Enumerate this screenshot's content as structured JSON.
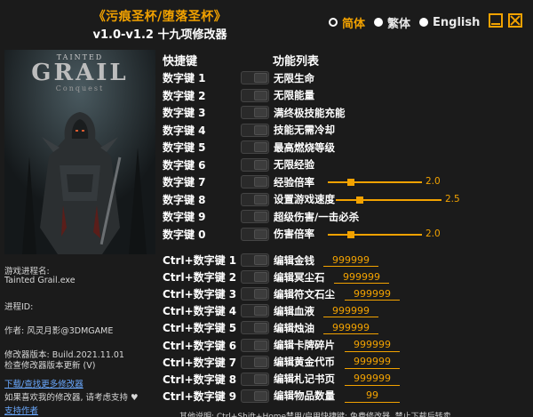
{
  "header": {
    "title": "《污痕圣杯/堕落圣杯》",
    "subtitle": "v1.0-v1.2 十九项修改器"
  },
  "languages": [
    {
      "label": "简体",
      "selected": true
    },
    {
      "label": "繁体",
      "selected": false
    },
    {
      "label": "English",
      "selected": false
    }
  ],
  "cover": {
    "small": "TAINTED",
    "big": "GRAIL",
    "sub": "Conquest"
  },
  "columns": {
    "hotkey": "快捷键",
    "feature": "功能列表"
  },
  "toggle_rows": [
    {
      "hotkey": "数字键 1",
      "feature": "无限生命"
    },
    {
      "hotkey": "数字键 2",
      "feature": "无限能量"
    },
    {
      "hotkey": "数字键 3",
      "feature": "满终极技能充能"
    },
    {
      "hotkey": "数字键 4",
      "feature": "技能无需冷却"
    },
    {
      "hotkey": "数字键 5",
      "feature": "最高燃烧等级"
    },
    {
      "hotkey": "数字键 6",
      "feature": "无限经验"
    },
    {
      "hotkey": "数字键 7",
      "feature": "经验倍率",
      "slider": "2.0",
      "level": 0.2
    },
    {
      "hotkey": "数字键 8",
      "feature": "设置游戏速度",
      "slider": "2.5",
      "level": 0.23
    },
    {
      "hotkey": "数字键 9",
      "feature": "超级伤害/一击必杀"
    },
    {
      "hotkey": "数字键 0",
      "feature": "伤害倍率",
      "slider": "2.0",
      "level": 0.2
    }
  ],
  "edit_rows": [
    {
      "hotkey": "Ctrl+数字键 1",
      "feature": "编辑金钱",
      "value": "999999"
    },
    {
      "hotkey": "Ctrl+数字键 2",
      "feature": "编辑冥尘石",
      "value": "999999"
    },
    {
      "hotkey": "Ctrl+数字键 3",
      "feature": "编辑符文石尘",
      "value": "999999"
    },
    {
      "hotkey": "Ctrl+数字键 4",
      "feature": "编辑血液",
      "value": "999999"
    },
    {
      "hotkey": "Ctrl+数字键 5",
      "feature": "编辑烛油",
      "value": "999999"
    },
    {
      "hotkey": "Ctrl+数字键 6",
      "feature": "编辑卡牌碎片",
      "value": "999999"
    },
    {
      "hotkey": "Ctrl+数字键 7",
      "feature": "编辑黄金代币",
      "value": "999999"
    },
    {
      "hotkey": "Ctrl+数字键 8",
      "feature": "编辑札记书页",
      "value": "999999"
    },
    {
      "hotkey": "Ctrl+数字键 9",
      "feature": "编辑物品数量",
      "value": "99"
    }
  ],
  "info": {
    "process_label": "游戏进程名:",
    "process_name": "Tainted Grail.exe",
    "pid_label": "进程ID:",
    "author": "作者: 风灵月影@3DMGAME",
    "version": "修改器版本: Build.2021.11.01",
    "check_update": "检查修改器版本更新 (V)",
    "download_more": "下载/查找更多修改器",
    "support_text": "如果喜欢我的修改器, 请考虑支持 ♥",
    "support_link": "支持作者"
  },
  "footer": "其他说明: Ctrl+Shift+Home禁用/启用快捷键; 免费修改器, 禁止下载后转卖"
}
